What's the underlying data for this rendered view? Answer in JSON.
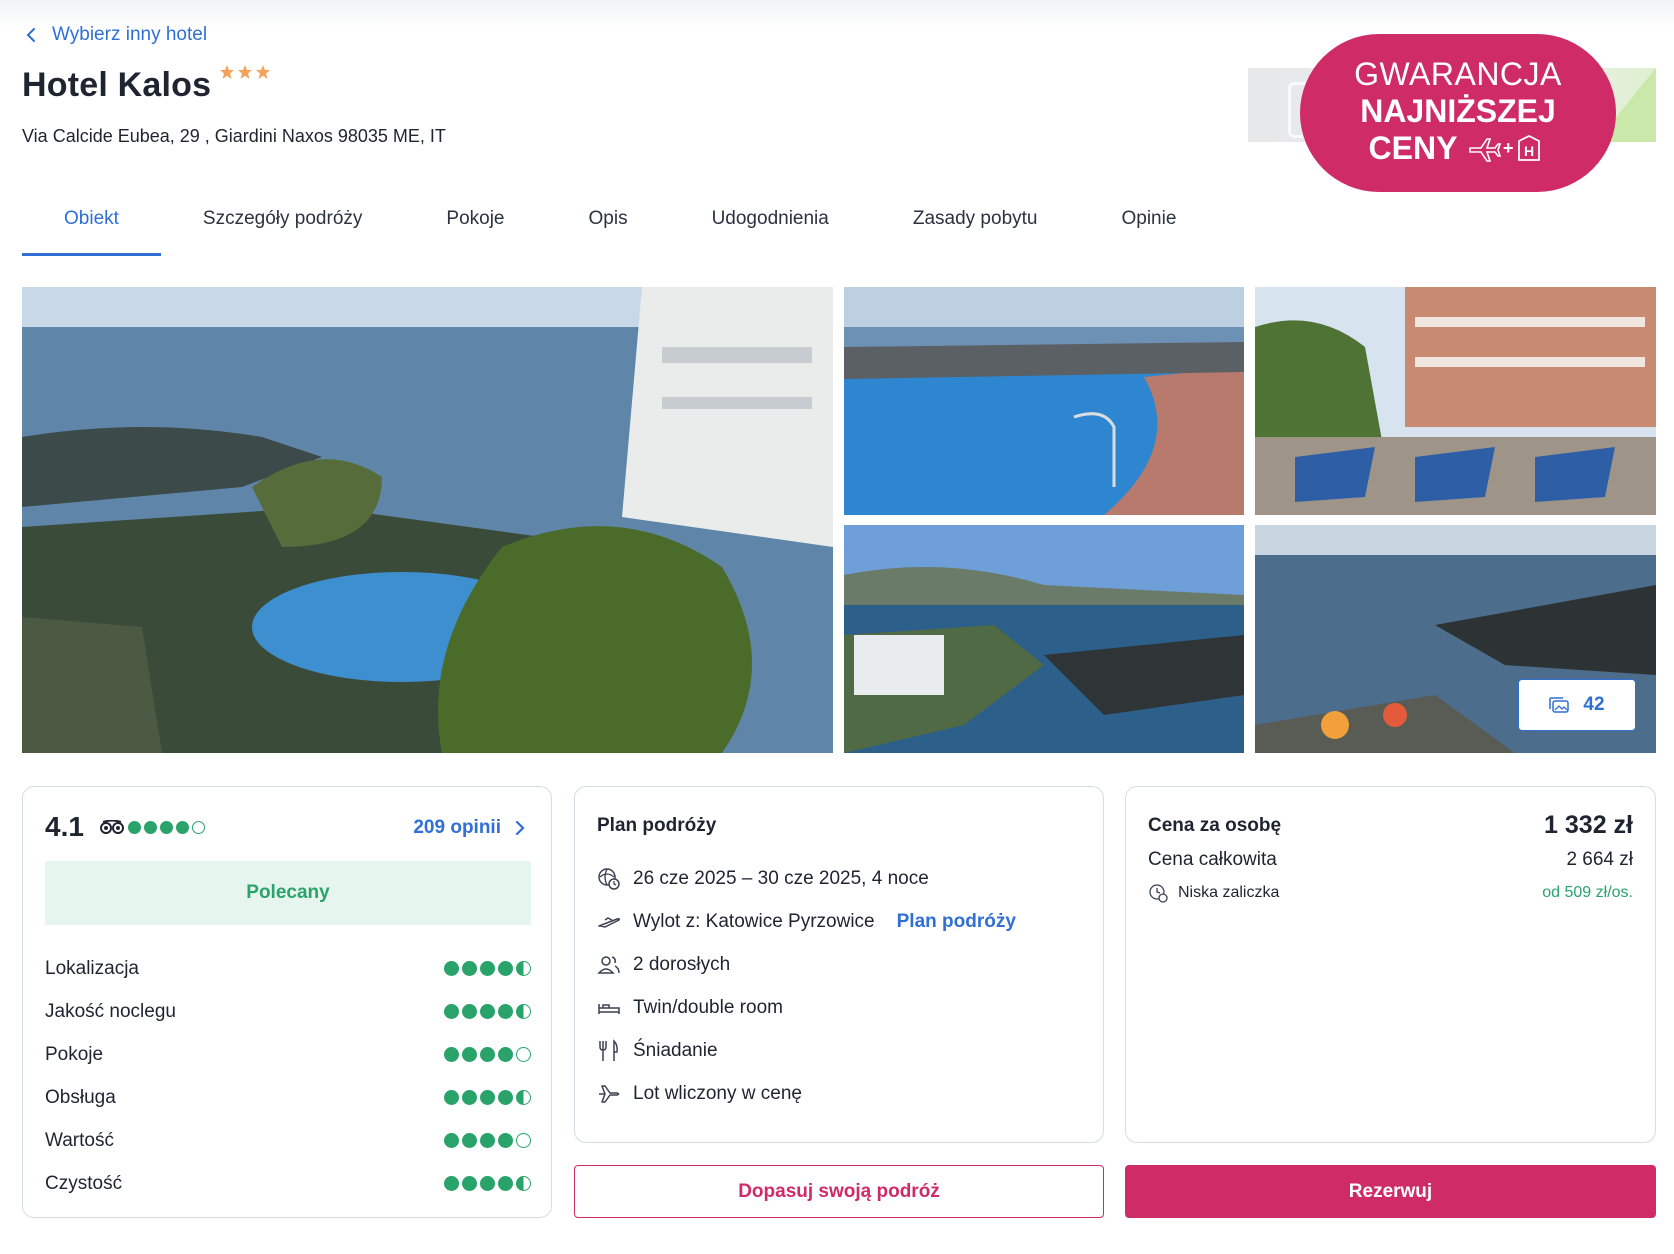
{
  "nav": {
    "back_label": "Wybierz inny hotel"
  },
  "hotel": {
    "name": "Hotel Kalos",
    "stars": 3,
    "address": "Via Calcide Eubea, 29 , Giardini Naxos 98035 ME, IT"
  },
  "guarantee": {
    "line1": "GWARANCJA",
    "line2": "NAJNIŻSZEJ",
    "line3": "CENY",
    "plus": "+",
    "h": "H"
  },
  "tabs": [
    {
      "label": "Obiekt",
      "active": true
    },
    {
      "label": "Szczegóły podróży",
      "active": false
    },
    {
      "label": "Pokoje",
      "active": false
    },
    {
      "label": "Opis",
      "active": false
    },
    {
      "label": "Udogodnienia",
      "active": false
    },
    {
      "label": "Zasady pobytu",
      "active": false
    },
    {
      "label": "Opinie",
      "active": false
    }
  ],
  "gallery": {
    "photo_count": "42"
  },
  "rating": {
    "score": "4.1",
    "overall_dots": 4,
    "reviews_label": "209 opinii",
    "badge": "Polecany",
    "categories": [
      {
        "label": "Lokalizacja",
        "dots": 4.5
      },
      {
        "label": "Jakość noclegu",
        "dots": 4.5
      },
      {
        "label": "Pokoje",
        "dots": 4
      },
      {
        "label": "Obsługa",
        "dots": 4.5
      },
      {
        "label": "Wartość",
        "dots": 4
      },
      {
        "label": "Czystość",
        "dots": 4.5
      }
    ]
  },
  "plan": {
    "title": "Plan podróży",
    "dates": "26 cze 2025 – 30 cze 2025, 4 noce",
    "departure": "Wylot z: Katowice Pyrzowice",
    "plan_link": "Plan podróży",
    "guests": "2 dorosłych",
    "room": "Twin/double room",
    "board": "Śniadanie",
    "flight": "Lot wliczony w cenę"
  },
  "price": {
    "per_person_label": "Cena za osobę",
    "per_person_value": "1 332 zł",
    "total_label": "Cena całkowita",
    "total_value": "2 664 zł",
    "deposit_label": "Niska zaliczka",
    "deposit_value": "od 509 zł/os."
  },
  "actions": {
    "customize": "Dopasuj swoją podróż",
    "book": "Rezerwuj"
  },
  "colors": {
    "accent": "#cf2b67",
    "link": "#2f6fd6",
    "rating_green": "#2aa36b",
    "star": "#f5a35c"
  }
}
